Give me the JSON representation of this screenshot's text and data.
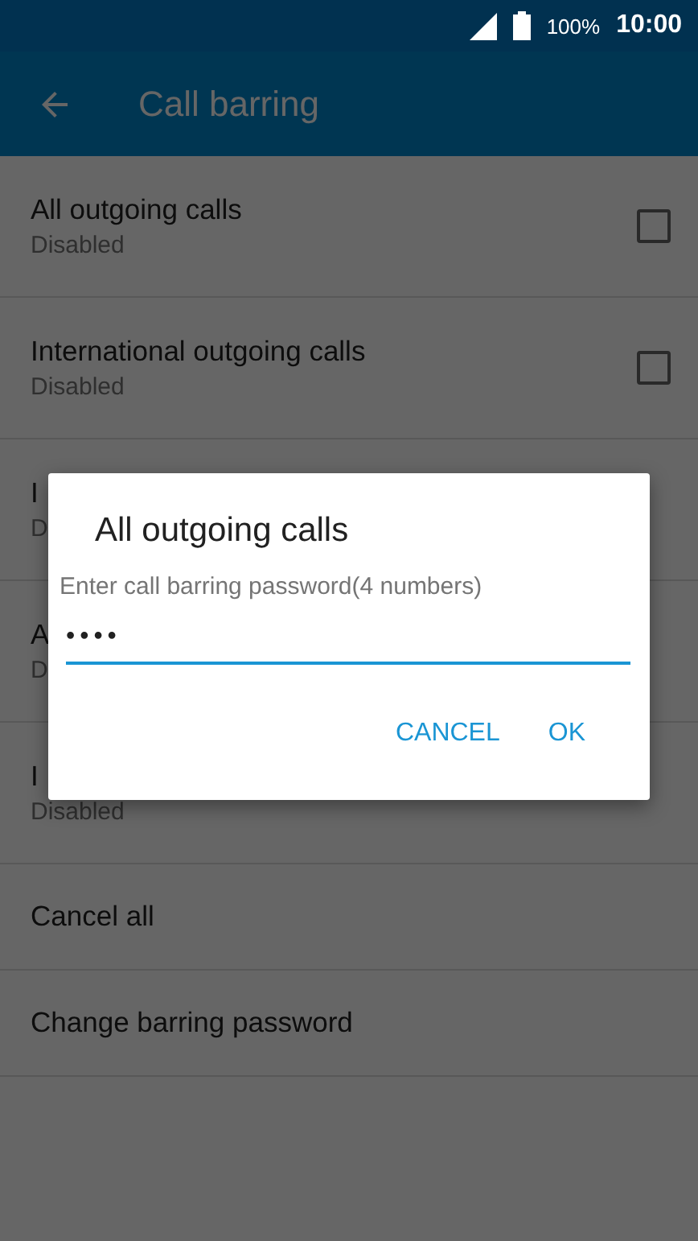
{
  "status_bar": {
    "battery": "100%",
    "time": "10:00"
  },
  "app_bar": {
    "title": "Call barring"
  },
  "settings": [
    {
      "kind": "checkbox",
      "title": "All outgoing calls",
      "subtitle": "Disabled",
      "checked": false
    },
    {
      "kind": "checkbox",
      "title": "International outgoing calls",
      "subtitle": "Disabled",
      "checked": false
    },
    {
      "kind": "checkbox",
      "title": "I",
      "subtitle": "D"
    },
    {
      "kind": "checkbox",
      "title": "A",
      "subtitle": "D"
    },
    {
      "kind": "checkbox",
      "title": "I",
      "subtitle": "Disabled"
    },
    {
      "kind": "action",
      "title": "Cancel all"
    },
    {
      "kind": "action",
      "title": "Change barring password"
    }
  ],
  "dialog": {
    "title": "All outgoing calls",
    "message": "Enter call barring password(4 numbers)",
    "password": "••••",
    "buttons": [
      "CANCEL",
      "OK"
    ]
  }
}
